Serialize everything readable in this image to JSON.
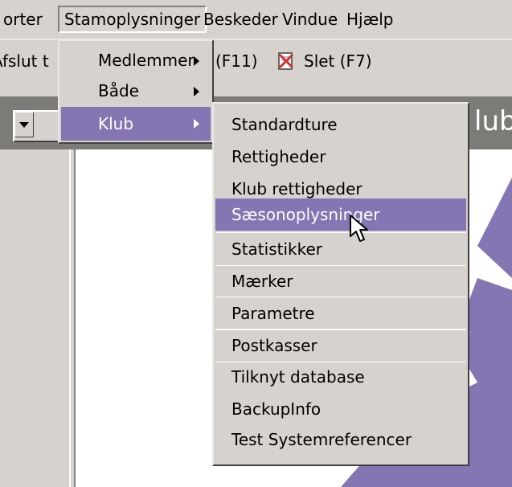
{
  "menubar": {
    "items": [
      {
        "label": "orter"
      },
      {
        "label": "Stamoplysninger"
      },
      {
        "label": "Beskeder"
      },
      {
        "label": "Vindue"
      },
      {
        "label": "Hjælp"
      }
    ]
  },
  "toolbar": {
    "afslut_label": "Afslut t",
    "f11_label": "(F11)",
    "slet_label": "Slet (F7)"
  },
  "titlebar": {
    "partial_title": "lub"
  },
  "stamoplysninger_menu": {
    "items": [
      {
        "label": "Medlemmer",
        "has_submenu": true
      },
      {
        "label": "Både",
        "has_submenu": true
      },
      {
        "label": "Klub",
        "has_submenu": true,
        "selected": true
      }
    ]
  },
  "klub_submenu": {
    "items": [
      {
        "label": "Standardture"
      },
      {
        "label": "Rettigheder"
      },
      {
        "label": "Klub rettigheder"
      },
      {
        "label": "Sæsonoplysninger",
        "selected": true
      },
      {
        "label": "Statistikker"
      },
      {
        "label": "Mærker"
      },
      {
        "label": "Parametre"
      },
      {
        "label": "Postkasser"
      },
      {
        "label": "Tilknyt database"
      },
      {
        "label": "BackupInfo"
      },
      {
        "label": "Test Systemreferencer"
      }
    ]
  },
  "colors": {
    "menu_bg": "#d6d3ce",
    "highlight": "#8575b2",
    "title_band": "#7d7b78",
    "logo_purple": "#8575b2"
  }
}
